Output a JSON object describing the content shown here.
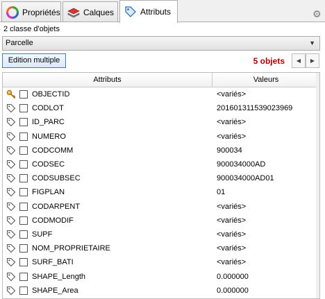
{
  "tabs": [
    {
      "label": "Propriétés",
      "icon": "color-wheel-icon"
    },
    {
      "label": "Calques",
      "icon": "layers-icon"
    },
    {
      "label": "Attributs",
      "icon": "tag-icon",
      "active": true
    }
  ],
  "header": {
    "class_count": "2 classe d'objets",
    "selected_class": "Parcelle",
    "multi_edit_label": "Edition multiple",
    "object_count": "5 objets"
  },
  "grid": {
    "columns": [
      "Attributs",
      "Valeurs"
    ],
    "rows": [
      {
        "icon": "key-icon",
        "name": "OBJECTID",
        "value": "<variés>"
      },
      {
        "icon": "tag-icon",
        "name": "CODLOT",
        "value": "201601311539023969"
      },
      {
        "icon": "tag-icon",
        "name": "ID_PARC",
        "value": "<variés>"
      },
      {
        "icon": "tag-icon",
        "name": "NUMERO",
        "value": "<variés>"
      },
      {
        "icon": "tag-icon",
        "name": "CODCOMM",
        "value": "900034"
      },
      {
        "icon": "tag-icon",
        "name": "CODSEC",
        "value": "900034000AD"
      },
      {
        "icon": "tag-icon",
        "name": "CODSUBSEC",
        "value": "900034000AD01"
      },
      {
        "icon": "tag-icon",
        "name": "FIGPLAN",
        "value": "01"
      },
      {
        "icon": "tag-icon",
        "name": "CODARPENT",
        "value": "<variés>"
      },
      {
        "icon": "tag-icon",
        "name": "CODMODIF",
        "value": "<variés>"
      },
      {
        "icon": "tag-icon",
        "name": "SUPF",
        "value": "<variés>"
      },
      {
        "icon": "tag-icon",
        "name": "NOM_PROPRIETAIRE",
        "value": "<variés>"
      },
      {
        "icon": "tag-icon",
        "name": "SURF_BATI",
        "value": "<variés>"
      },
      {
        "icon": "tag-icon",
        "name": "SHAPE_Length",
        "value": "0.000000"
      },
      {
        "icon": "tag-icon",
        "name": "SHAPE_Area",
        "value": "0.000000"
      }
    ]
  },
  "colors": {
    "accent": "#3a78c9",
    "count_color": "#b00000"
  }
}
